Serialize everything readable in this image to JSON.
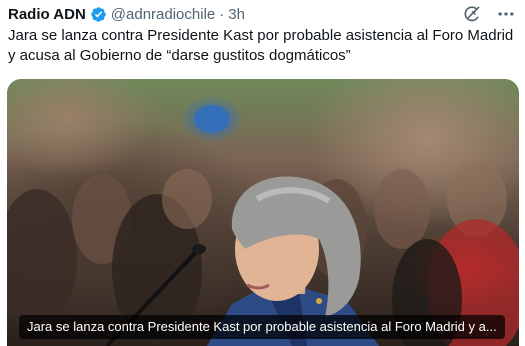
{
  "tweet": {
    "author": "Radio ADN",
    "handle": "@adnradiochile",
    "separator": "·",
    "time": "3h",
    "text": "Jara se lanza contra Presidente Kast por probable asistencia al Foro Madrid y acusa al Gobierno de “darse gustitos dogmáticos”",
    "verified_color": "#1d9bf0",
    "icons": {
      "grok": "grok-icon",
      "more": "more-options-icon",
      "verified": "verified-badge-icon"
    }
  },
  "media": {
    "caption": "Jara se lanza contra Presidente Kast por probable asistencia al Foro Madrid y a..."
  }
}
